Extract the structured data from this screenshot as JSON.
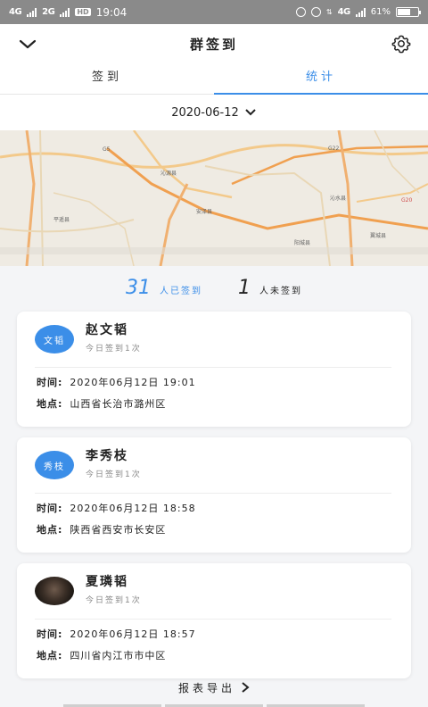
{
  "status_bar": {
    "network1": "4G",
    "network2": "2G",
    "hd_badge": "HD",
    "time": "19:04",
    "network3": "4G",
    "battery": "61%"
  },
  "header": {
    "title": "群签到"
  },
  "tabs": [
    {
      "label": "签到",
      "active": false
    },
    {
      "label": "统计",
      "active": true
    }
  ],
  "date_picker": {
    "value": "2020-06-12"
  },
  "map": {
    "labels": [
      "G5",
      "G22",
      "沁源县",
      "平遥县",
      "沁水县",
      "安泽县",
      "G20",
      "阳城县",
      "翼城县"
    ]
  },
  "summary": {
    "signed_count": "31",
    "signed_label": "人已签到",
    "unsigned_count": "1",
    "unsigned_label": "人未签到"
  },
  "records": [
    {
      "avatar_text": "文韬",
      "name": "赵文韬",
      "count_text": "今日签到1次",
      "time_label": "时间:",
      "time": "2020年06月12日 19:01",
      "location_label": "地点:",
      "location": "山西省长治市潞州区"
    },
    {
      "avatar_text": "秀枝",
      "name": "李秀枝",
      "count_text": "今日签到1次",
      "time_label": "时间:",
      "time": "2020年06月12日 18:58",
      "location_label": "地点:",
      "location": "陕西省西安市长安区"
    },
    {
      "avatar_text": "",
      "name": "夏璘韬",
      "count_text": "今日签到1次",
      "time_label": "时间:",
      "time": "2020年06月12日 18:57",
      "location_label": "地点:",
      "location": "四川省内江市市中区"
    }
  ],
  "export": {
    "label": "报表导出"
  },
  "colors": {
    "accent": "#3b8ee8",
    "status_bar": "#8a8a8a",
    "background": "#f4f5f7"
  }
}
